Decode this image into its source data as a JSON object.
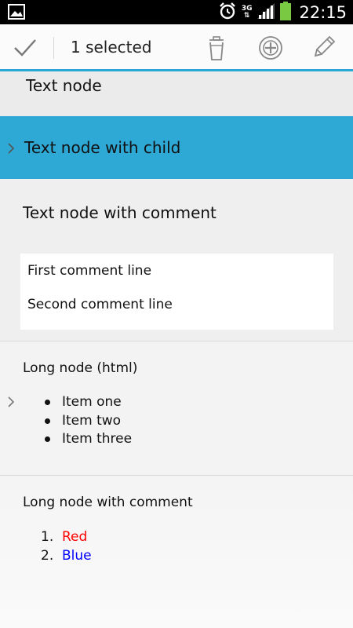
{
  "status_bar": {
    "network": "3G",
    "time": "22:15",
    "icons": [
      "image-notification-icon",
      "alarm-icon",
      "network-3g-icon",
      "signal-icon",
      "battery-icon"
    ]
  },
  "action_bar": {
    "title": "1 selected",
    "accent": "#2aa8d5",
    "icons": [
      "check-icon",
      "trash-icon",
      "add-circle-icon",
      "pencil-icon"
    ]
  },
  "nodes": [
    {
      "label": "Text node"
    },
    {
      "label": "Text node with child",
      "selected": true,
      "selected_color": "#2ea8d5"
    },
    {
      "label": "Text node with comment",
      "comment": [
        "First comment line",
        "Second comment line"
      ]
    },
    {
      "label": "Long node (html)",
      "items": [
        "Item one",
        "Item two",
        "Item three"
      ]
    },
    {
      "label": "Long node with comment",
      "ordered_items": [
        {
          "num": "1.",
          "text": "Red",
          "color": "#ff0000"
        },
        {
          "num": "2.",
          "text": "Blue",
          "color": "#0000ff"
        }
      ]
    }
  ]
}
